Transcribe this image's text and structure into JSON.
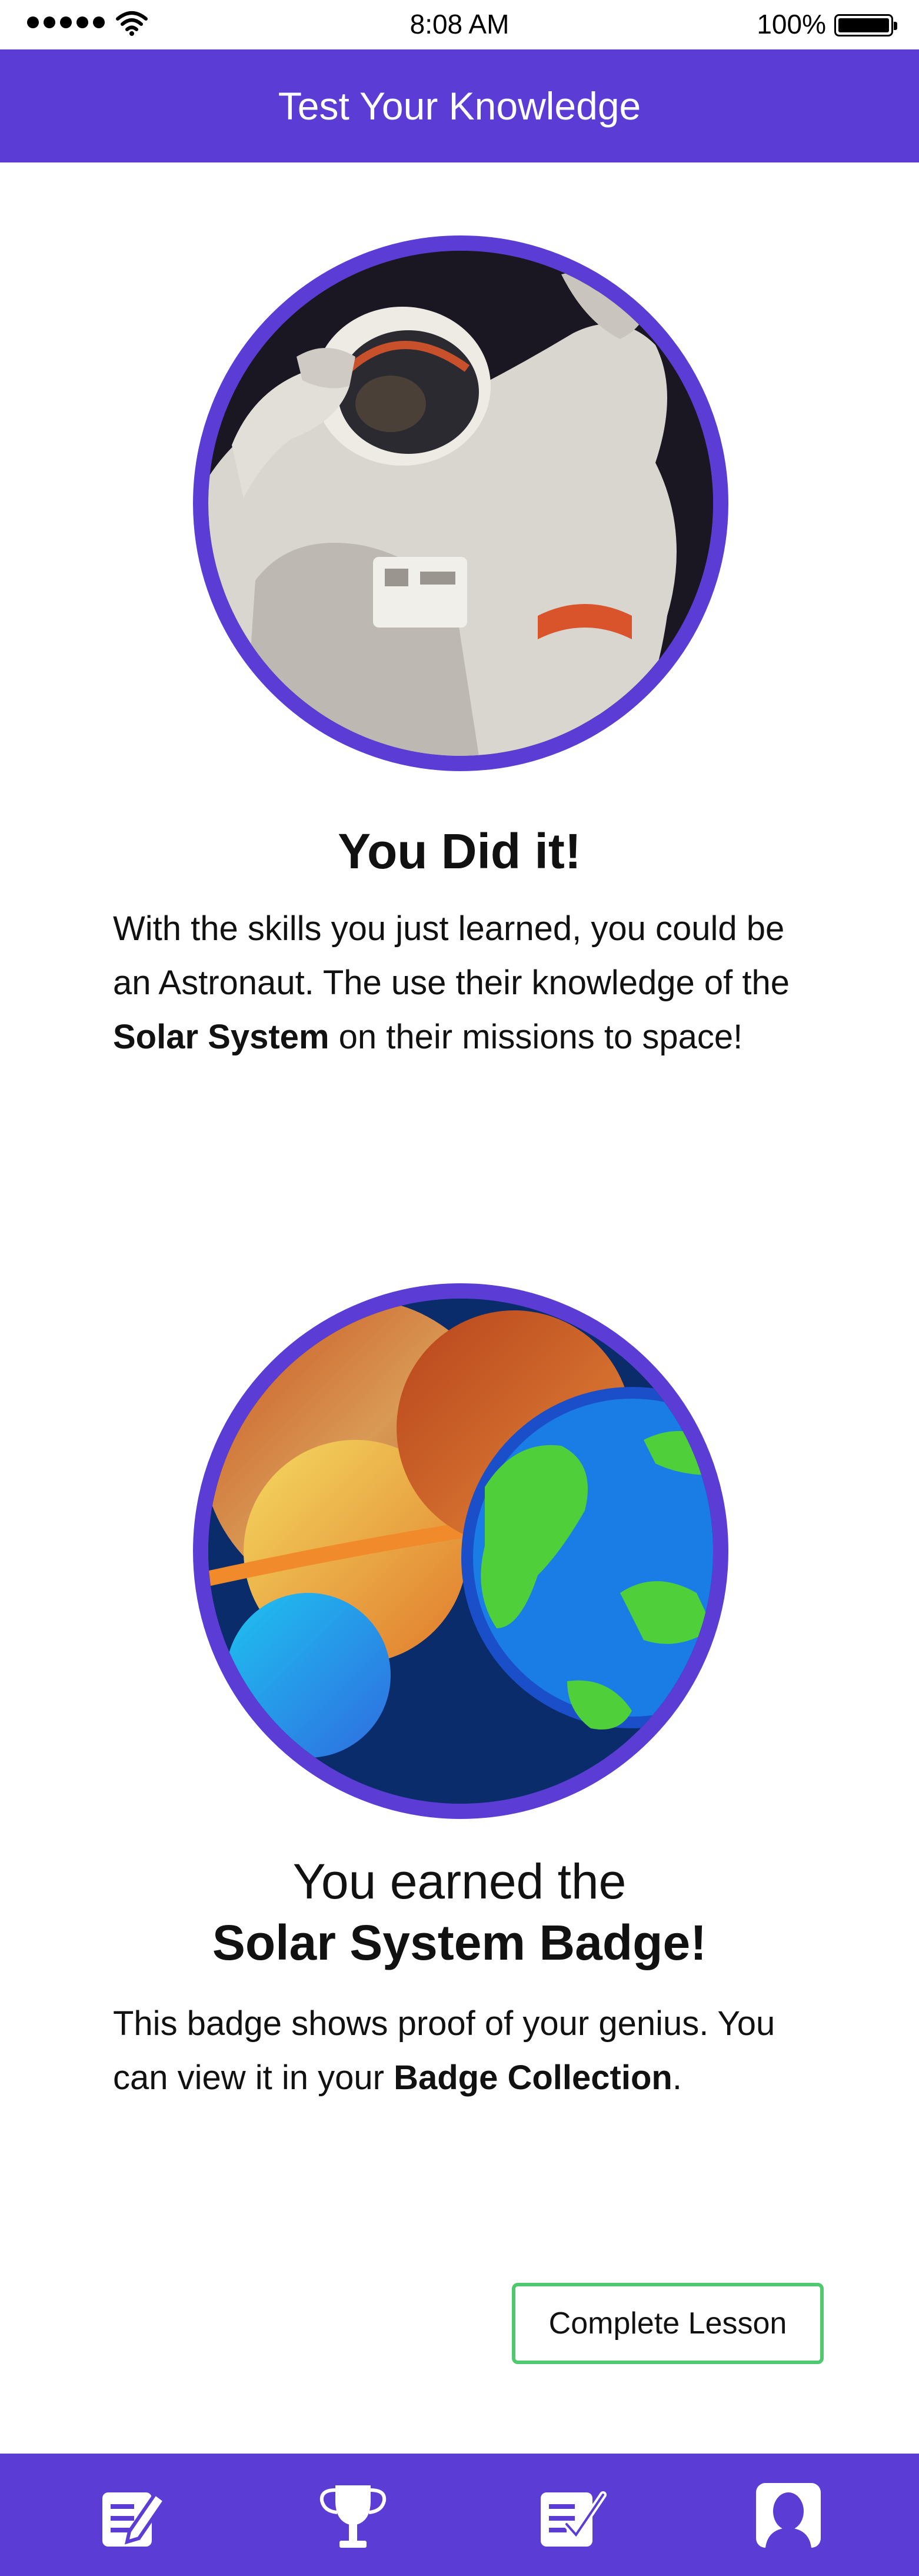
{
  "status_bar": {
    "time": "8:08 AM",
    "battery": "100%",
    "icons": [
      "signal-dots-icon",
      "wifi-icon",
      "battery-icon"
    ]
  },
  "header": {
    "title": "Test Your Knowledge"
  },
  "result": {
    "heading": "You Did it!",
    "body_part1": "With the skills you just learned, you could be an Astronaut. The use their knowledge of the ",
    "body_bold": "Solar System",
    "body_part2": " on their missions to space!"
  },
  "badge": {
    "line1": "You earned the",
    "line2": "Solar System Badge!",
    "body_part1": "This badge shows proof of your genius. You can view it in your ",
    "body_bold": "Badge Collection",
    "body_part2": "."
  },
  "actions": {
    "complete_label": "Complete Lesson"
  },
  "tab_bar": {
    "tabs": [
      {
        "icon": "lesson-edit-icon"
      },
      {
        "icon": "trophy-icon"
      },
      {
        "icon": "checklist-icon"
      },
      {
        "icon": "profile-icon"
      }
    ]
  },
  "colors": {
    "primary": "#5b3dd6",
    "button_border": "#4fc870",
    "text": "#111111",
    "white": "#ffffff"
  }
}
